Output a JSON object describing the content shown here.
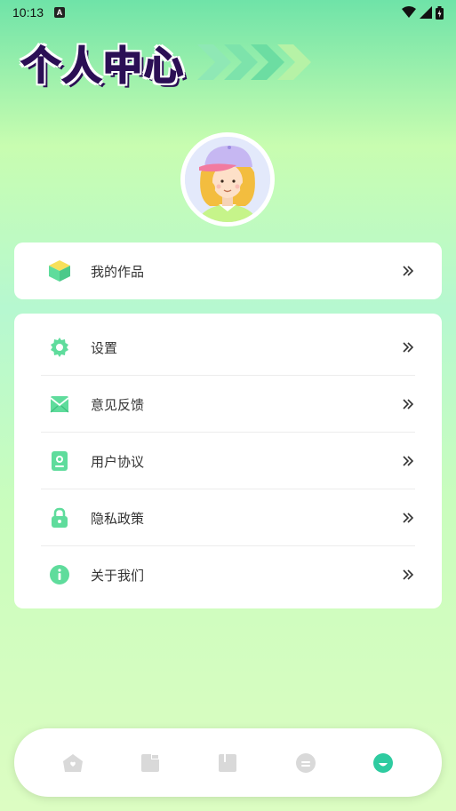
{
  "status_bar": {
    "time": "10:13",
    "notification_icon": "A"
  },
  "header": {
    "title": "个人中心"
  },
  "works_card": {
    "label": "我的作品",
    "icon": "cube-icon"
  },
  "settings_menu": {
    "items": [
      {
        "label": "设置",
        "icon": "gear-icon"
      },
      {
        "label": "意见反馈",
        "icon": "mail-icon"
      },
      {
        "label": "用户协议",
        "icon": "user-card-icon"
      },
      {
        "label": "隐私政策",
        "icon": "lock-icon"
      },
      {
        "label": "关于我们",
        "icon": "info-icon"
      }
    ]
  },
  "tab_bar": {
    "tabs": [
      {
        "icon": "home-icon",
        "active": false
      },
      {
        "icon": "gallery-icon",
        "active": false
      },
      {
        "icon": "book-icon",
        "active": false
      },
      {
        "icon": "face-neutral-icon",
        "active": false
      },
      {
        "icon": "face-smile-icon",
        "active": true
      }
    ]
  },
  "colors": {
    "accent": "#5fdc9c",
    "title": "#2b0f55",
    "active_tab": "#2ecba0",
    "inactive_tab": "#d9d9d9"
  }
}
